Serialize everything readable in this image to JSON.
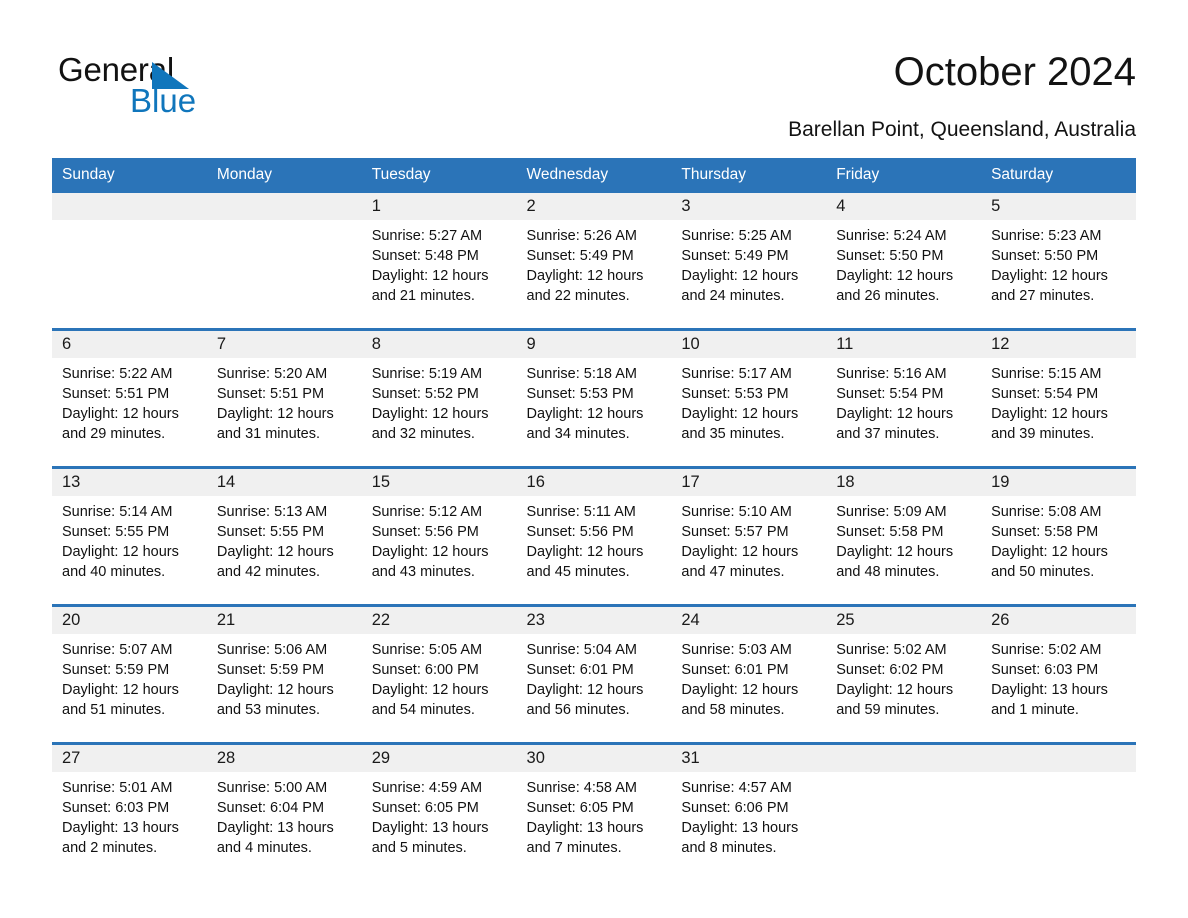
{
  "logo": {
    "word1": "General",
    "word2": "Blue",
    "triangle_color": "#1076BC"
  },
  "header": {
    "title": "October 2024",
    "subtitle": "Barellan Point, Queensland, Australia"
  },
  "theme": {
    "header_blue": "#2B74B8",
    "daynum_band": "#f0f0f0",
    "page_background": "#ffffff"
  },
  "calendar": {
    "weekday_headers": [
      "Sunday",
      "Monday",
      "Tuesday",
      "Wednesday",
      "Thursday",
      "Friday",
      "Saturday"
    ],
    "labels": {
      "sunrise": "Sunrise:",
      "sunset": "Sunset:",
      "daylight": "Daylight:"
    },
    "weeks": [
      [
        {
          "day": "",
          "sunrise": "",
          "sunset": "",
          "daylight": "",
          "empty": true
        },
        {
          "day": "",
          "sunrise": "",
          "sunset": "",
          "daylight": "",
          "empty": true
        },
        {
          "day": "1",
          "sunrise": "Sunrise: 5:27 AM",
          "sunset": "Sunset: 5:48 PM",
          "daylight": "Daylight: 12 hours and 21 minutes."
        },
        {
          "day": "2",
          "sunrise": "Sunrise: 5:26 AM",
          "sunset": "Sunset: 5:49 PM",
          "daylight": "Daylight: 12 hours and 22 minutes."
        },
        {
          "day": "3",
          "sunrise": "Sunrise: 5:25 AM",
          "sunset": "Sunset: 5:49 PM",
          "daylight": "Daylight: 12 hours and 24 minutes."
        },
        {
          "day": "4",
          "sunrise": "Sunrise: 5:24 AM",
          "sunset": "Sunset: 5:50 PM",
          "daylight": "Daylight: 12 hours and 26 minutes."
        },
        {
          "day": "5",
          "sunrise": "Sunrise: 5:23 AM",
          "sunset": "Sunset: 5:50 PM",
          "daylight": "Daylight: 12 hours and 27 minutes."
        }
      ],
      [
        {
          "day": "6",
          "sunrise": "Sunrise: 5:22 AM",
          "sunset": "Sunset: 5:51 PM",
          "daylight": "Daylight: 12 hours and 29 minutes."
        },
        {
          "day": "7",
          "sunrise": "Sunrise: 5:20 AM",
          "sunset": "Sunset: 5:51 PM",
          "daylight": "Daylight: 12 hours and 31 minutes."
        },
        {
          "day": "8",
          "sunrise": "Sunrise: 5:19 AM",
          "sunset": "Sunset: 5:52 PM",
          "daylight": "Daylight: 12 hours and 32 minutes."
        },
        {
          "day": "9",
          "sunrise": "Sunrise: 5:18 AM",
          "sunset": "Sunset: 5:53 PM",
          "daylight": "Daylight: 12 hours and 34 minutes."
        },
        {
          "day": "10",
          "sunrise": "Sunrise: 5:17 AM",
          "sunset": "Sunset: 5:53 PM",
          "daylight": "Daylight: 12 hours and 35 minutes."
        },
        {
          "day": "11",
          "sunrise": "Sunrise: 5:16 AM",
          "sunset": "Sunset: 5:54 PM",
          "daylight": "Daylight: 12 hours and 37 minutes."
        },
        {
          "day": "12",
          "sunrise": "Sunrise: 5:15 AM",
          "sunset": "Sunset: 5:54 PM",
          "daylight": "Daylight: 12 hours and 39 minutes."
        }
      ],
      [
        {
          "day": "13",
          "sunrise": "Sunrise: 5:14 AM",
          "sunset": "Sunset: 5:55 PM",
          "daylight": "Daylight: 12 hours and 40 minutes."
        },
        {
          "day": "14",
          "sunrise": "Sunrise: 5:13 AM",
          "sunset": "Sunset: 5:55 PM",
          "daylight": "Daylight: 12 hours and 42 minutes."
        },
        {
          "day": "15",
          "sunrise": "Sunrise: 5:12 AM",
          "sunset": "Sunset: 5:56 PM",
          "daylight": "Daylight: 12 hours and 43 minutes."
        },
        {
          "day": "16",
          "sunrise": "Sunrise: 5:11 AM",
          "sunset": "Sunset: 5:56 PM",
          "daylight": "Daylight: 12 hours and 45 minutes."
        },
        {
          "day": "17",
          "sunrise": "Sunrise: 5:10 AM",
          "sunset": "Sunset: 5:57 PM",
          "daylight": "Daylight: 12 hours and 47 minutes."
        },
        {
          "day": "18",
          "sunrise": "Sunrise: 5:09 AM",
          "sunset": "Sunset: 5:58 PM",
          "daylight": "Daylight: 12 hours and 48 minutes."
        },
        {
          "day": "19",
          "sunrise": "Sunrise: 5:08 AM",
          "sunset": "Sunset: 5:58 PM",
          "daylight": "Daylight: 12 hours and 50 minutes."
        }
      ],
      [
        {
          "day": "20",
          "sunrise": "Sunrise: 5:07 AM",
          "sunset": "Sunset: 5:59 PM",
          "daylight": "Daylight: 12 hours and 51 minutes."
        },
        {
          "day": "21",
          "sunrise": "Sunrise: 5:06 AM",
          "sunset": "Sunset: 5:59 PM",
          "daylight": "Daylight: 12 hours and 53 minutes."
        },
        {
          "day": "22",
          "sunrise": "Sunrise: 5:05 AM",
          "sunset": "Sunset: 6:00 PM",
          "daylight": "Daylight: 12 hours and 54 minutes."
        },
        {
          "day": "23",
          "sunrise": "Sunrise: 5:04 AM",
          "sunset": "Sunset: 6:01 PM",
          "daylight": "Daylight: 12 hours and 56 minutes."
        },
        {
          "day": "24",
          "sunrise": "Sunrise: 5:03 AM",
          "sunset": "Sunset: 6:01 PM",
          "daylight": "Daylight: 12 hours and 58 minutes."
        },
        {
          "day": "25",
          "sunrise": "Sunrise: 5:02 AM",
          "sunset": "Sunset: 6:02 PM",
          "daylight": "Daylight: 12 hours and 59 minutes."
        },
        {
          "day": "26",
          "sunrise": "Sunrise: 5:02 AM",
          "sunset": "Sunset: 6:03 PM",
          "daylight": "Daylight: 13 hours and 1 minute."
        }
      ],
      [
        {
          "day": "27",
          "sunrise": "Sunrise: 5:01 AM",
          "sunset": "Sunset: 6:03 PM",
          "daylight": "Daylight: 13 hours and 2 minutes."
        },
        {
          "day": "28",
          "sunrise": "Sunrise: 5:00 AM",
          "sunset": "Sunset: 6:04 PM",
          "daylight": "Daylight: 13 hours and 4 minutes."
        },
        {
          "day": "29",
          "sunrise": "Sunrise: 4:59 AM",
          "sunset": "Sunset: 6:05 PM",
          "daylight": "Daylight: 13 hours and 5 minutes."
        },
        {
          "day": "30",
          "sunrise": "Sunrise: 4:58 AM",
          "sunset": "Sunset: 6:05 PM",
          "daylight": "Daylight: 13 hours and 7 minutes."
        },
        {
          "day": "31",
          "sunrise": "Sunrise: 4:57 AM",
          "sunset": "Sunset: 6:06 PM",
          "daylight": "Daylight: 13 hours and 8 minutes."
        },
        {
          "day": "",
          "sunrise": "",
          "sunset": "",
          "daylight": "",
          "empty": true
        },
        {
          "day": "",
          "sunrise": "",
          "sunset": "",
          "daylight": "",
          "empty": true
        }
      ]
    ]
  }
}
